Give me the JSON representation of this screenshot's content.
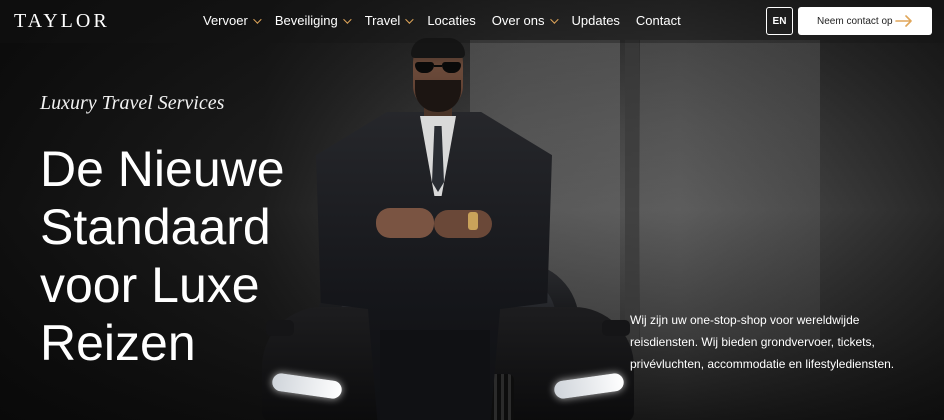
{
  "nav": {
    "logo": "TAYLOR",
    "items": [
      {
        "label": "Vervoer",
        "dropdown": true
      },
      {
        "label": "Beveiliging",
        "dropdown": true
      },
      {
        "label": "Travel",
        "dropdown": true
      },
      {
        "label": "Locaties",
        "dropdown": false
      },
      {
        "label": "Over ons",
        "dropdown": true
      },
      {
        "label": "Updates",
        "dropdown": false
      },
      {
        "label": "Contact",
        "dropdown": false
      }
    ],
    "language": "EN",
    "cta_label": "Neem contact op"
  },
  "hero": {
    "tagline": "Luxury Travel Services",
    "headline": "De Nieuwe Standaard voor Luxe Reizen",
    "intro": "Wij zijn uw one-stop-shop voor wereldwijde reisdiensten. Wij bieden grondvervoer, tickets, privévluchten, accommodatie en lifestylediensten."
  },
  "colors": {
    "accent": "#e0a65a",
    "cta_background": "#ffffff"
  },
  "icons": {
    "dropdown": "chevron-down-icon",
    "cta": "arrow-right-icon"
  }
}
